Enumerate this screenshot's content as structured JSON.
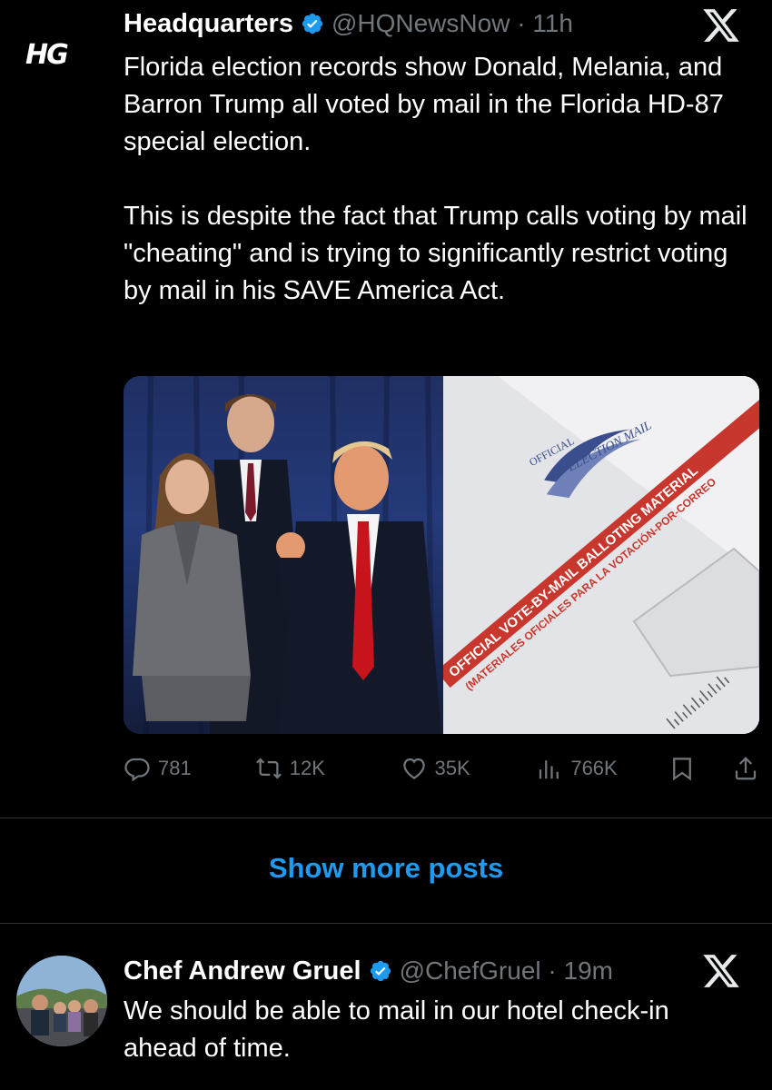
{
  "post1": {
    "avatar_text": "HG",
    "name": "Headquarters",
    "handle_time": "@HQNewsNow · 11h",
    "paragraph1": "Florida election records show Donald, Melania, and Barron Trump all voted by mail in the Florida HD-87 special election.",
    "paragraph2": "This is despite the fact that Trump calls voting by mail \"cheating\" and is trying to significantly restrict voting by mail in his SAVE America Act.",
    "image_right": {
      "official": "OFFICIAL",
      "election_mail": "ELECTION MAIL",
      "red_line1": "OFFICIAL VOTE-BY-MAIL BALLOTING MATERIAL",
      "red_line2": "(MATERIALES OFICIALES PARA LA VOTACIÓN-POR-CORREO"
    },
    "actions": {
      "replies": "781",
      "reposts": "12K",
      "likes": "35K",
      "views": "766K"
    }
  },
  "show_more_label": "Show more posts",
  "post2": {
    "name": "Chef Andrew Gruel",
    "handle_time": "@ChefGruel · 19m",
    "text": "We should be able to mail in our hotel check-in ahead of time."
  },
  "colors": {
    "background": "#000000",
    "accent": "#1d9bf0",
    "muted": "#71767b",
    "verified": "#1d9bf0"
  }
}
